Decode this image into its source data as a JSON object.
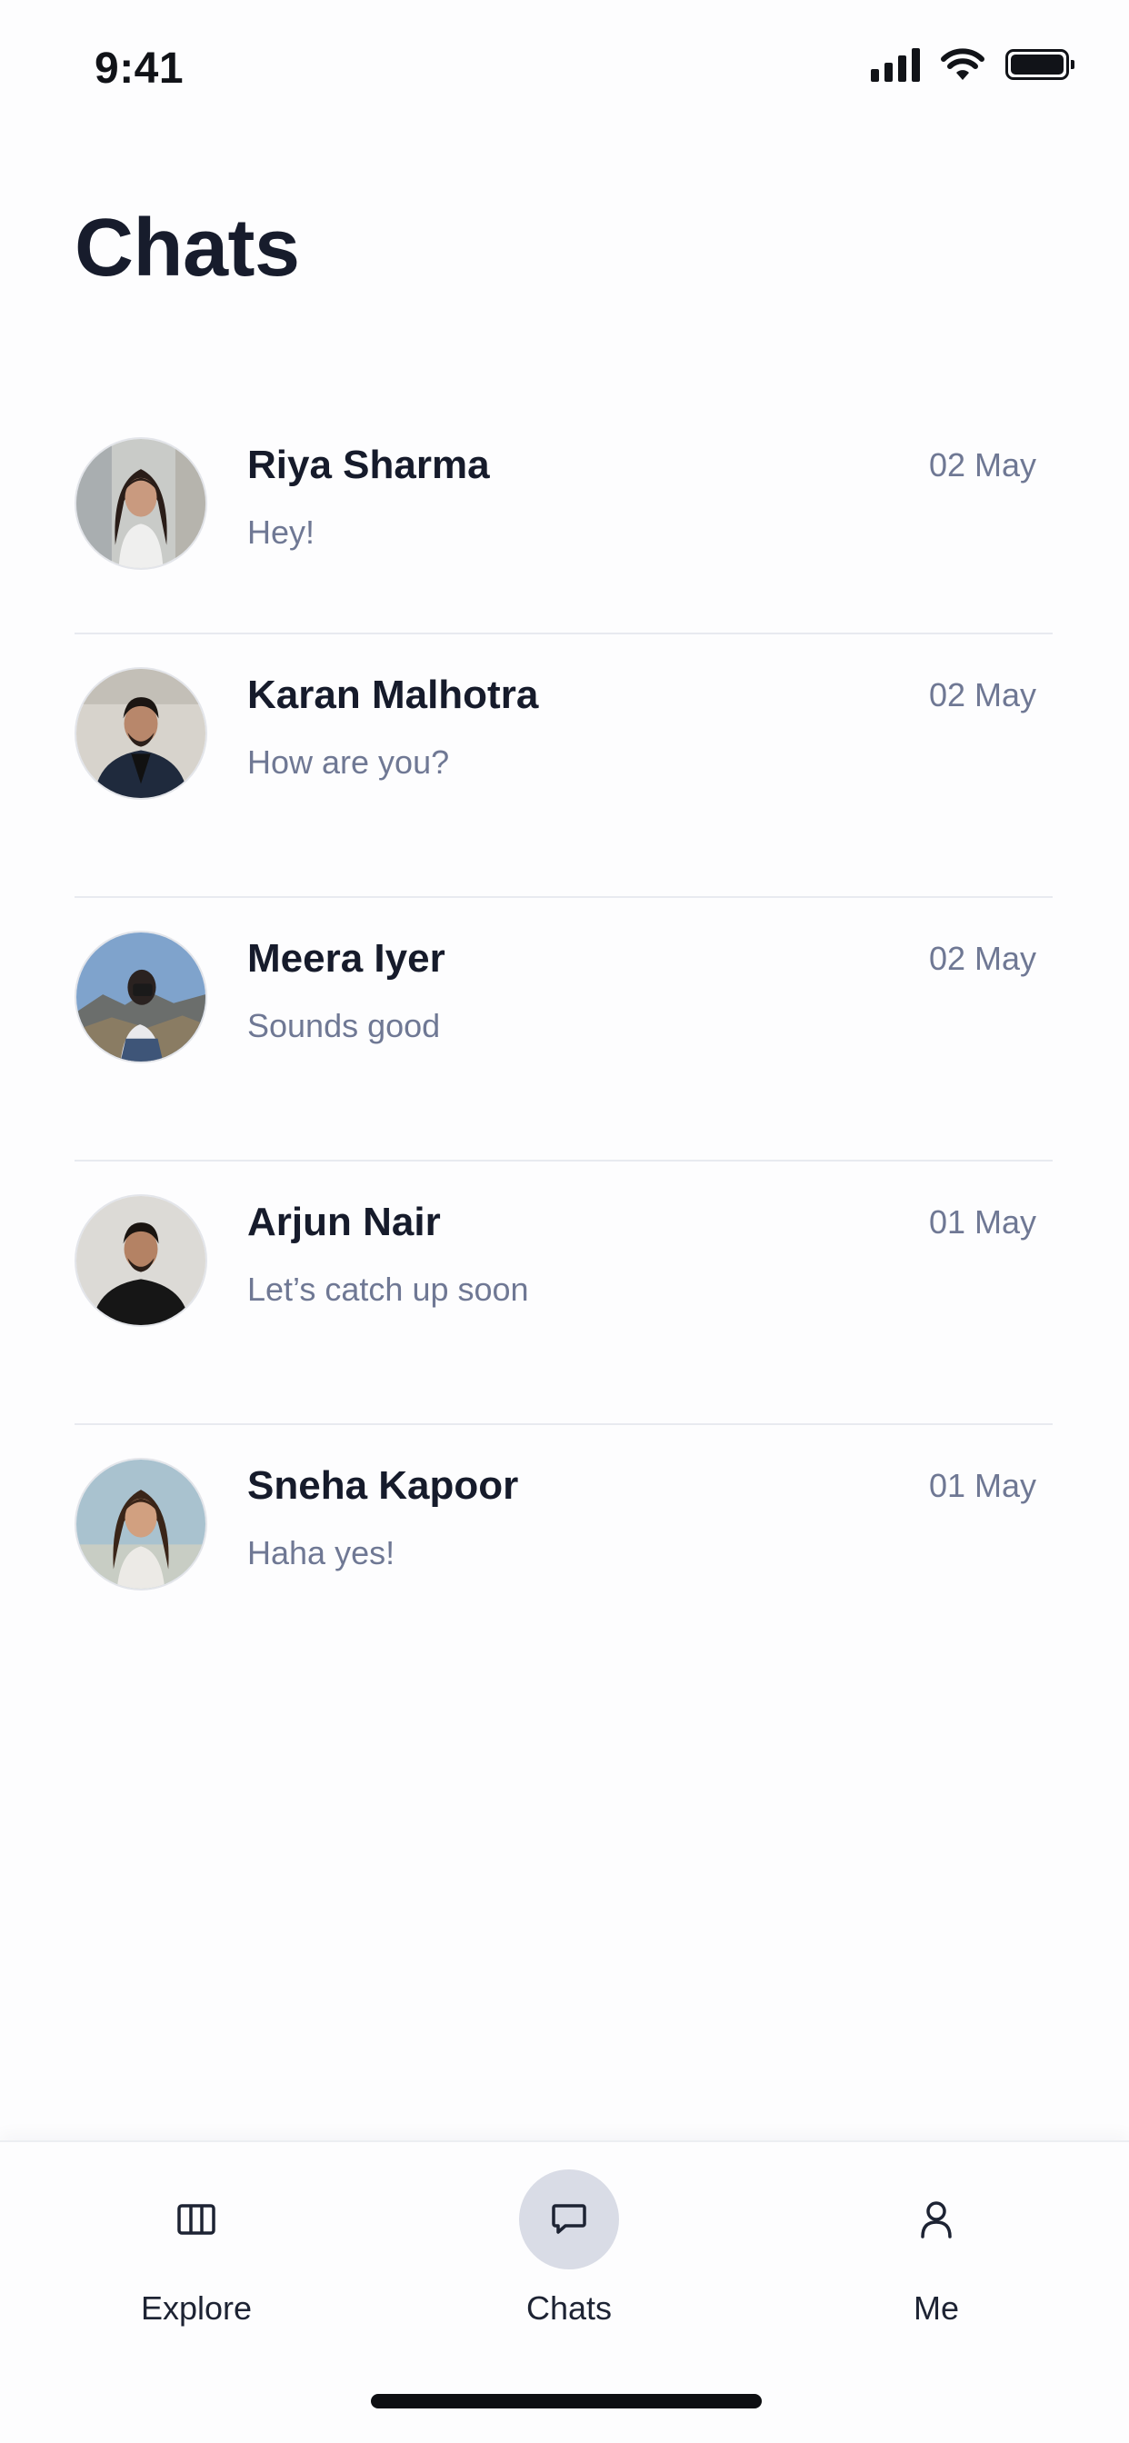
{
  "status_bar": {
    "time": "9:41",
    "icons": [
      "cellular-signal-icon",
      "wifi-icon",
      "battery-icon"
    ]
  },
  "header": {
    "title": "Chats"
  },
  "chats": [
    {
      "name": "Riya Sharma",
      "preview": "Hey!",
      "date": "02 May",
      "avatar": "woman-dark-hair-avatar"
    },
    {
      "name": "Karan Malhotra",
      "preview": "How are you?",
      "date": "02 May",
      "avatar": "man-blazer-avatar"
    },
    {
      "name": "Meera Iyer",
      "preview": "Sounds good",
      "date": "02 May",
      "avatar": "woman-mountain-photo-avatar"
    },
    {
      "name": "Arjun Nair",
      "preview": "Let’s catch up soon",
      "date": "01 May",
      "avatar": "man-black-tshirt-avatar"
    },
    {
      "name": "Sneha Kapoor",
      "preview": "Haha yes!",
      "date": "01 May",
      "avatar": "woman-smiling-avatar"
    }
  ],
  "tab_bar": {
    "active": "Chats",
    "tabs": [
      {
        "label": "Explore",
        "icon": "columns-icon"
      },
      {
        "label": "Chats",
        "icon": "chat-bubble-icon"
      },
      {
        "label": "Me",
        "icon": "person-icon"
      }
    ]
  },
  "colors": {
    "background": "#fdfdfe",
    "title_text": "#171c2c",
    "secondary_text": "#6f7894",
    "divider": "#e8eaf0",
    "active_tab_bg": "#d9dce6"
  }
}
